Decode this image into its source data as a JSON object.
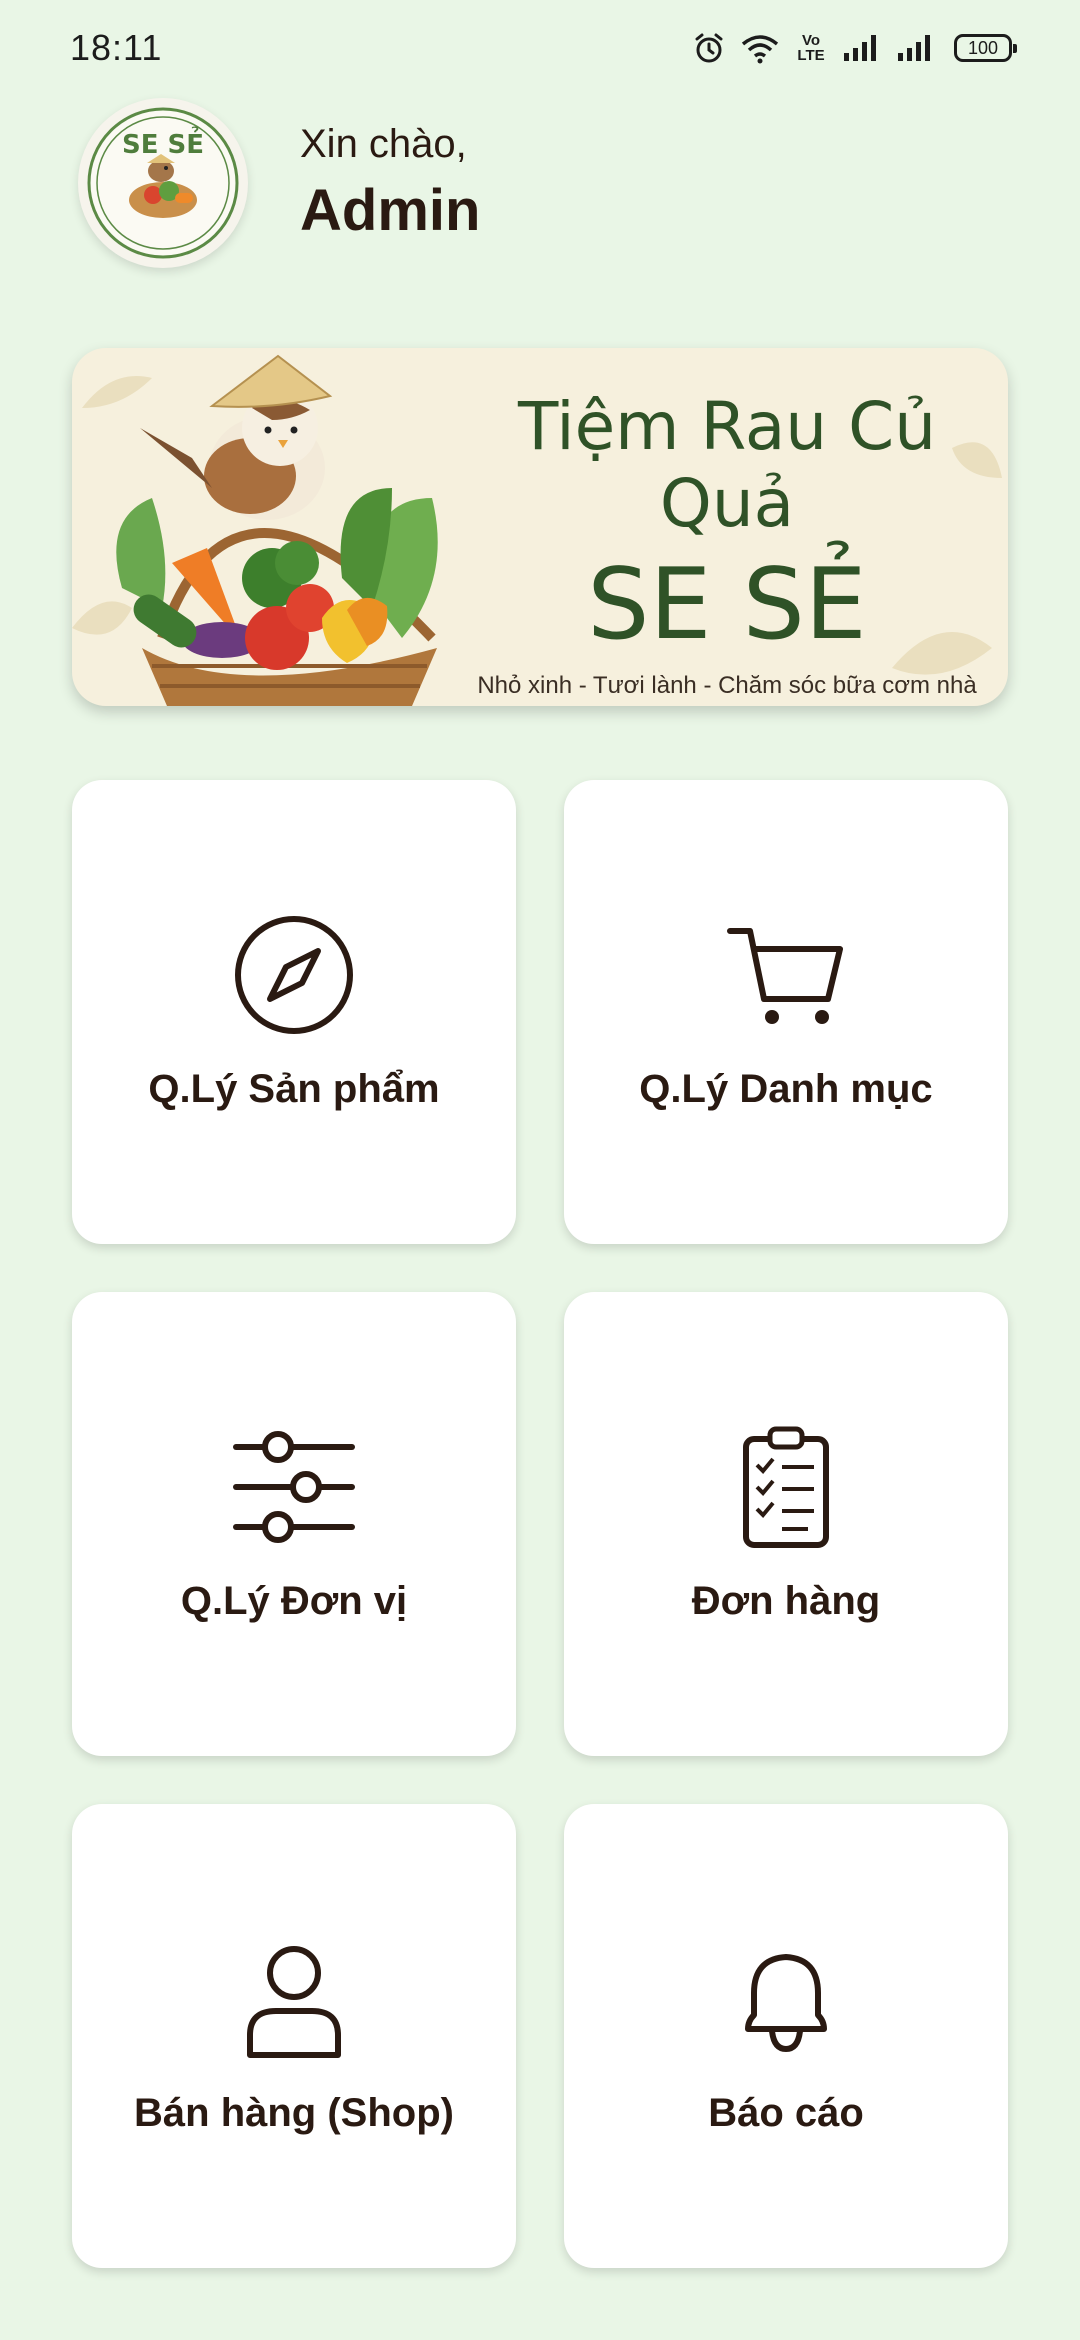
{
  "status_bar": {
    "time": "18:11",
    "volte": "Vo LTE",
    "battery": "100"
  },
  "header": {
    "greeting": "Xin chào,",
    "user_name": "Admin",
    "logo_text": "SE SẺ"
  },
  "banner": {
    "title": "Tiệm Rau Củ Quả",
    "brand": "SE SẺ",
    "tagline": "Nhỏ xinh - Tươi lành - Chăm sóc bữa cơm nhà"
  },
  "menu": {
    "items": [
      {
        "label": "Q.Lý Sản phẩm",
        "icon": "compass-icon"
      },
      {
        "label": "Q.Lý Danh mục",
        "icon": "cart-icon"
      },
      {
        "label": "Q.Lý Đơn vị",
        "icon": "sliders-icon"
      },
      {
        "label": "Đơn hàng",
        "icon": "clipboard-checklist-icon"
      },
      {
        "label": "Bán hàng (Shop)",
        "icon": "person-icon"
      },
      {
        "label": "Báo cáo",
        "icon": "bell-icon"
      }
    ]
  },
  "colors": {
    "background": "#e9f6e6",
    "text_dark": "#2a1a12",
    "brand_green": "#2f5227",
    "banner_bg": "#f6f0dd"
  }
}
